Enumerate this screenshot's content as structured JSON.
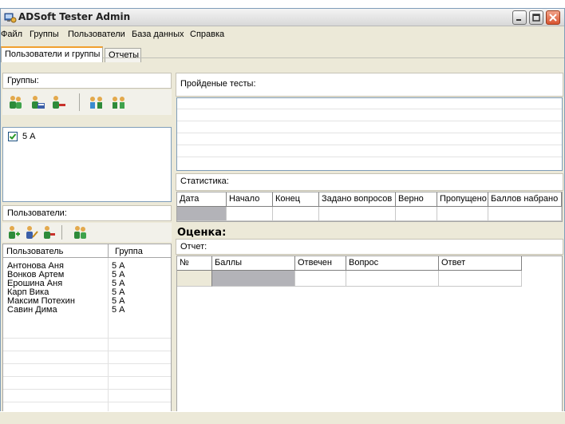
{
  "window": {
    "title": "ADSoft Tester Admin",
    "controls": {
      "minimize": "minimize-icon",
      "maximize": "maximize-icon",
      "close": "close-icon"
    }
  },
  "menu": [
    "Файл",
    "Группы",
    "Пользователи",
    "База данных",
    "Справка"
  ],
  "tabs": [
    {
      "label": "Пользователи и группы",
      "active": true
    },
    {
      "label": "Отчеты",
      "active": false
    }
  ],
  "groups": {
    "header": "Группы:",
    "toolbar_icons": [
      "add-group-icon",
      "edit-group-icon",
      "delete-group-icon",
      "group-users-icon",
      "group-members-icon"
    ],
    "items": [
      {
        "label": "5 А",
        "checked": true
      }
    ]
  },
  "users": {
    "header": "Пользователи:",
    "toolbar_icons": [
      "add-user-icon",
      "edit-user-icon",
      "delete-user-icon",
      "user-group-icon"
    ],
    "columns": [
      "Пользователь",
      "Группа"
    ],
    "rows": [
      {
        "name": "Антонова Аня",
        "group": "5 А"
      },
      {
        "name": "Вонков Артем",
        "group": "5 А"
      },
      {
        "name": "Ерошина Аня",
        "group": "5 А"
      },
      {
        "name": "Карп Вика",
        "group": "5 А"
      },
      {
        "name": "Максим Потехин",
        "group": "5 А"
      },
      {
        "name": "Савин Дима",
        "group": "5 А"
      }
    ]
  },
  "tests": {
    "header": "Пройденые тесты:"
  },
  "stats": {
    "header": "Статистика:",
    "columns": [
      "Дата",
      "Начало",
      "Конец",
      "Задано вопросов",
      "Верно",
      "Пропущено",
      "Баллов набрано"
    ]
  },
  "rating": {
    "label": "Оценка:"
  },
  "report": {
    "header": "Отчет:",
    "columns": [
      "№",
      "Баллы",
      "Отвечен",
      "Вопрос",
      "Ответ"
    ]
  }
}
